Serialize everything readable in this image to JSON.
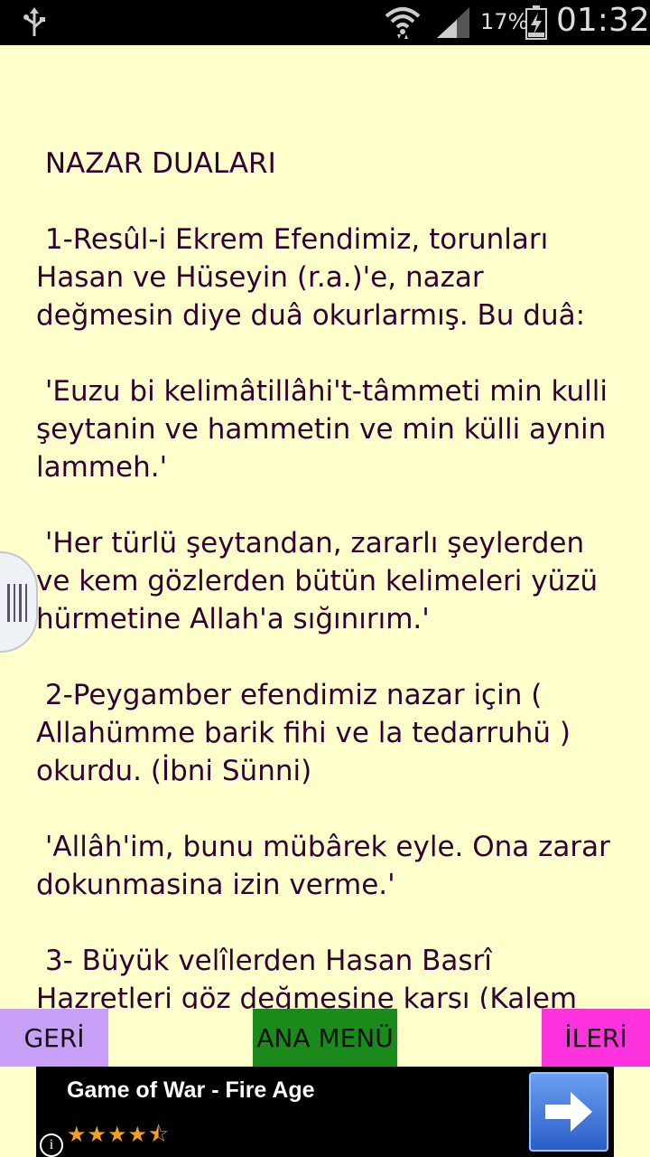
{
  "status_bar": {
    "battery_percent": "17%",
    "time": "01:32"
  },
  "article": {
    "title": "NAZAR DUALARI",
    "paragraphs": [
      "1-Resûl-i Ekrem Efendimiz, torunları Hasan ve Hüseyin (r.a.)'e, nazar değmesin diye duâ okurlarmış. Bu duâ:",
      "'Euzu bi kelimâtillâhi't-tâmmeti min kulli şeytanin ve hammetin ve min külli aynin lammeh.'",
      "'Her türlü şeytandan, zararlı şeylerden ve kem gözlerden bütün kelimeleri yüzü hürmetine Allah'a sığınırım.'",
      "2-Peygamber efendimiz nazar için ( Allahümme barik fihi ve la tedarruhü ) okurdu. (İbni Sünni)",
      "'Allâh'im, bunu mübârek eyle. Ona zarar dokunmasina izin verme.'",
      "3- Büyük velîlerden Hasan Basrî Hazretleri göz değmesine karşı (Kalem"
    ]
  },
  "nav": {
    "back_label": "GERİ",
    "menu_label": "ANA MENÜ",
    "next_label": "İLERİ"
  },
  "ad": {
    "title": "Game of War - Fire Age",
    "rating": "4.5",
    "stars_text": "★★★★⯪",
    "info_label": "i"
  },
  "icons": {
    "usb": "usb-icon",
    "wifi": "wifi-icon",
    "signal": "signal-icon",
    "battery": "battery-charging-icon",
    "ad_cta": "arrow-right-icon"
  }
}
